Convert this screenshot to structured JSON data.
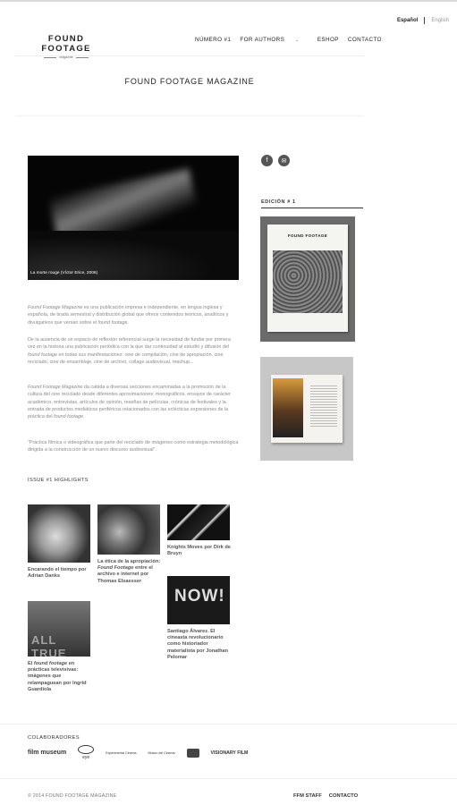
{
  "lang": {
    "es": "Español",
    "en": "English"
  },
  "logo": {
    "title": "FOUND FOOTAGE",
    "subtitle": "Magazine"
  },
  "nav": {
    "items": [
      "NÚMERO #1",
      "FOR AUTHORS",
      "ESHOP",
      "CONTACTO"
    ]
  },
  "page": {
    "title": "FOUND FOOTAGE MAGAZINE"
  },
  "hero": {
    "caption": "La morte rouge (Víctor Erice, 2006)"
  },
  "body": {
    "p1_a": "Found Footage Magazine",
    "p1_b": " es una publicación impresa e independiente, en lengua inglesa y española, de tirada semestral y distribución global que ofrece contenidos teóricos, analíticos y divulgativos que versan sobre el ",
    "p1_c": "found footage",
    "p1_d": ".",
    "p2_a": "De la ausencia de un espacio de reflexión referencial surge la necesidad de fundar por primera vez en la historia una publicación periódica con la que dar continuidad al estudio y difusión del ",
    "p2_b": "found footage",
    "p2_c": " en todas sus manifestaciones: cine de compilación, cine de apropiación, cine reciclado, cine de ensamblaje, cine de archivo, collage audiovisual, mashup...",
    "p3_a": "Found Footage Magazine",
    "p3_b": " da cabida a diversas secciones encaminadas a la promoción de la cultura del cine reciclado desde diferentes aproximaciones: monográficos, ensayos de carácter académico, entrevistas, artículos de opinión, reseñas de películas, crónicas de festivales y la entrada de productos mediáticos periféricos relacionados con las eclécticas expresiones de la práctica del ",
    "p3_c": "found footage",
    "p3_d": ".",
    "p4": "\"Práctica fílmica o videográfica que parte del reciclado de imágenes como estrategia metodológica dirigida a la construcción de un nuevo discurso audiovisual\"."
  },
  "highlights": {
    "title": "ISSUE #1 HIGHLIGHTS",
    "c1": "Encarando el tiempo por Adrian Danks",
    "c2_a": "La ética de la apropiación: ",
    "c2_b": "Found Footage",
    "c2_c": " entre el archivo e internet por Thomas Elsaesser",
    "c3": "Knights Moves por Dirk de Bruyn",
    "c4": "Santiago Álvarez. El cineasta revolucionario como historiador materialista por Jonathan Pelomar",
    "c4_img": "NOW!",
    "c5_a": "El ",
    "c5_b": "found footage",
    "c5_c": " en prácticas televisivas: imágenes que relampaguean por Ingrid Guardiola",
    "c5_img": "ALL TRUE"
  },
  "sidebar": {
    "facebook_glyph": "f",
    "mail_glyph": "✉",
    "edition_label": "EDICIÓN # 1",
    "book_title": "FOUND FOOTAGE"
  },
  "footer": {
    "colab_title": "COLABORADORES",
    "logos": [
      "film museum",
      "eye",
      "Experimental Cinema",
      "Museo del Cinema",
      "VISIONARY FILM"
    ],
    "copyright": "© 2014 FOUND FOOTAGE MAGAZINE",
    "links": [
      "FFM STAFF",
      "CONTACTO"
    ]
  },
  "colors": {
    "text": "#333333",
    "muted": "#8a8a8a",
    "rule": "#eeeeee"
  }
}
